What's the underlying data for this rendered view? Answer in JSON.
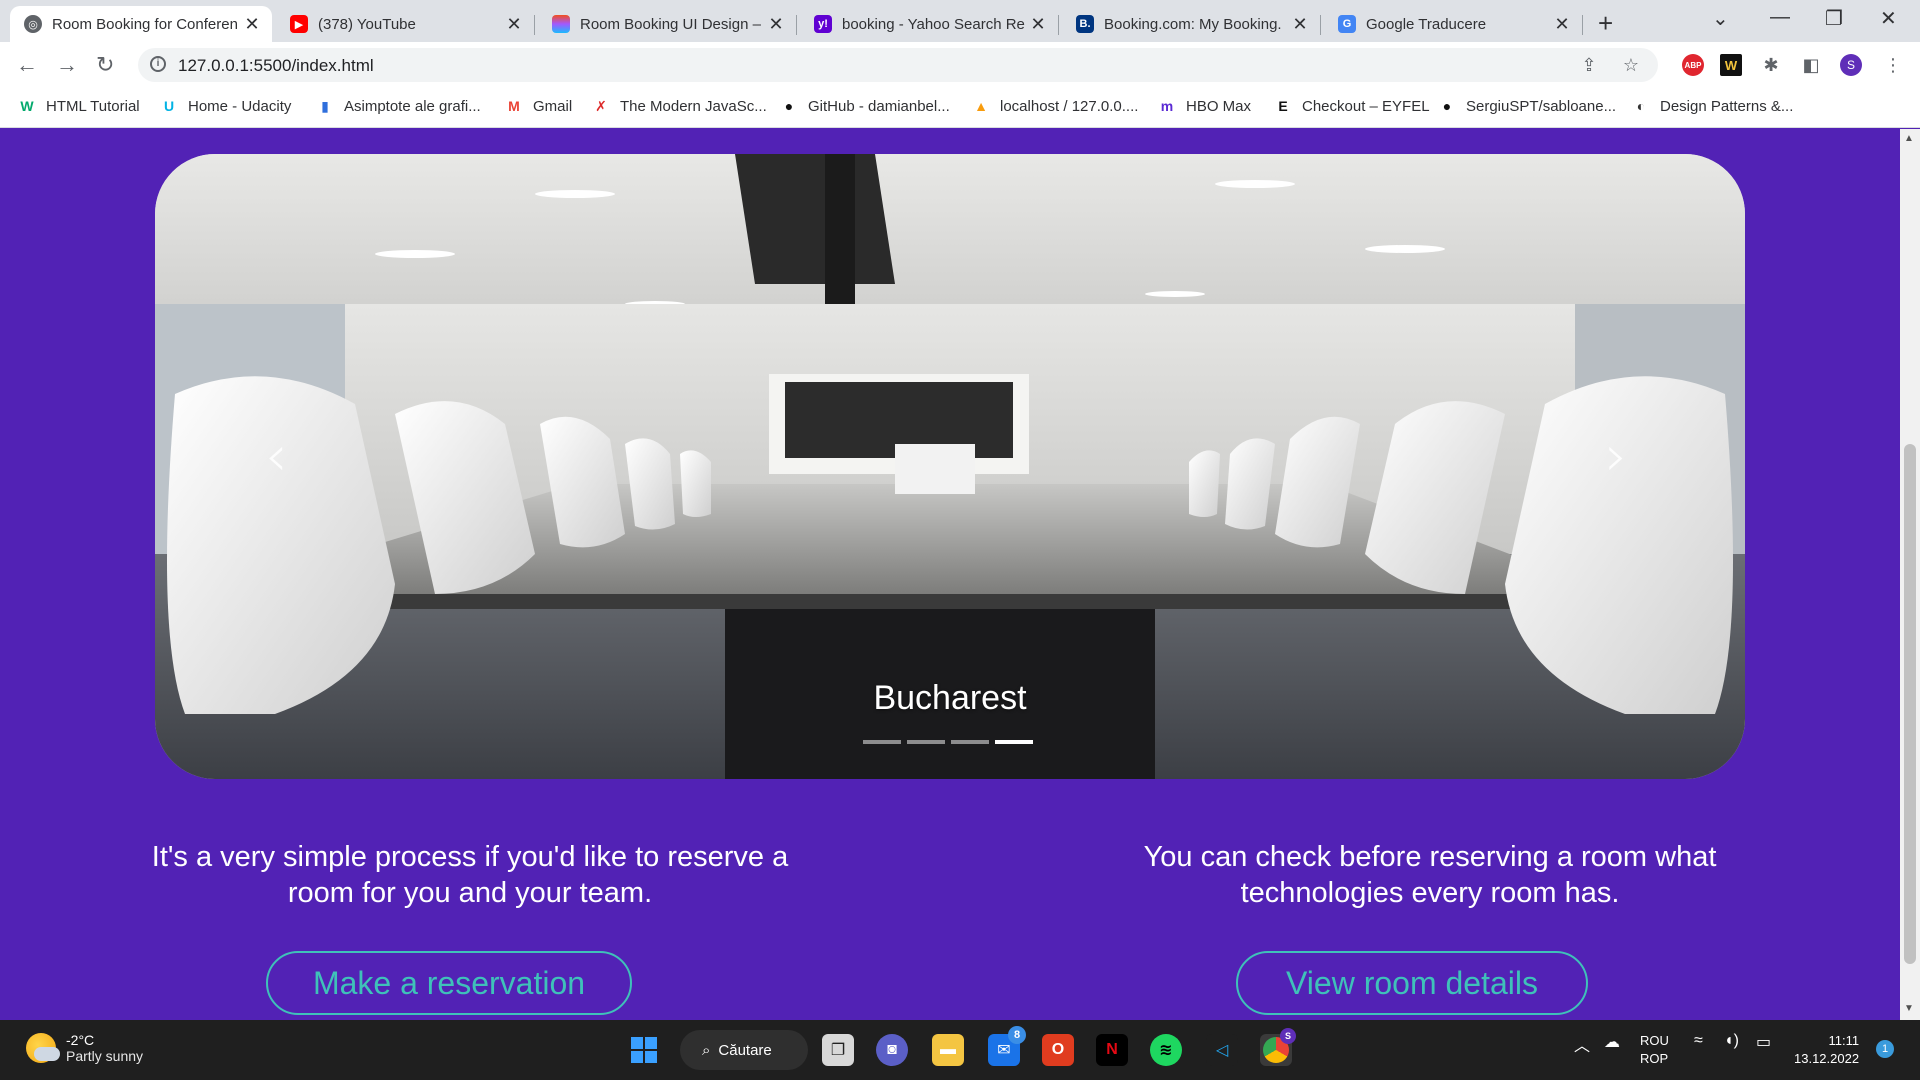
{
  "browser": {
    "tabs": [
      {
        "title": "Room Booking for Conferen",
        "favicon": "globe-icon",
        "active": true
      },
      {
        "title": "(378) YouTube",
        "favicon": "youtube-icon",
        "active": false
      },
      {
        "title": "Room Booking UI Design –",
        "favicon": "figma-icon",
        "active": false
      },
      {
        "title": "booking - Yahoo Search Re",
        "favicon": "yahoo-icon",
        "active": false
      },
      {
        "title": "Booking.com: My Booking.",
        "favicon": "booking-icon",
        "active": false
      },
      {
        "title": "Google Traducere",
        "favicon": "google-translate-icon",
        "active": false
      }
    ],
    "url": "127.0.0.1:5500/index.html",
    "profile_initial": "S",
    "extensions": {
      "abp_label": "ABP",
      "w_label": "W"
    }
  },
  "bookmarks": [
    {
      "label": "HTML Tutorial",
      "icon": "w3schools-icon",
      "glyph": "W",
      "color": "#04aa6d"
    },
    {
      "label": "Home - Udacity",
      "icon": "udacity-icon",
      "glyph": "U",
      "color": "#02b3e4"
    },
    {
      "label": "Asimptote ale grafi...",
      "icon": "bookmark-icon",
      "glyph": "▮",
      "color": "#2f6fdc"
    },
    {
      "label": "Gmail",
      "icon": "gmail-icon",
      "glyph": "M",
      "color": "#ea4335"
    },
    {
      "label": "The Modern JavaSc...",
      "icon": "javascript-info-icon",
      "glyph": "✗",
      "color": "#dd2a2a"
    },
    {
      "label": "GitHub - damianbel...",
      "icon": "github-icon",
      "glyph": "●",
      "color": "#111111"
    },
    {
      "label": "localhost / 127.0.0....",
      "icon": "phpmyadmin-icon",
      "glyph": "▲",
      "color": "#f89c0e"
    },
    {
      "label": "HBO Max",
      "icon": "hbo-max-icon",
      "glyph": "m",
      "color": "#5b2bd4"
    },
    {
      "label": "Checkout – EYFEL",
      "icon": "eyfel-icon",
      "glyph": "E",
      "color": "#111111"
    },
    {
      "label": "SergiuSPT/sabloane...",
      "icon": "github-icon",
      "glyph": "●",
      "color": "#111111"
    },
    {
      "label": "Design Patterns &...",
      "icon": "globe-icon",
      "glyph": "◐",
      "color": "#333333"
    }
  ],
  "carousel": {
    "caption": "Bucharest",
    "slide_count": 4,
    "active_slide_index": 3
  },
  "sections": [
    {
      "text": "It's a very simple process if you'd like to reserve a room for you and your team.",
      "button": "Make a reservation"
    },
    {
      "text": "You can check before reserving a room what technologies every room has.",
      "button": "View room details"
    }
  ],
  "taskbar": {
    "weather_temp": "-2°C",
    "weather_desc": "Partly sunny",
    "search_label": "Căutare",
    "mail_badge": "8",
    "chrome_badge": "S",
    "language_1": "ROU",
    "language_2": "ROP",
    "time": "11:11",
    "date": "13.12.2022",
    "notification_count": "1"
  },
  "colors": {
    "page_background": "#5222b5",
    "button_accent": "#3fc1b9"
  }
}
